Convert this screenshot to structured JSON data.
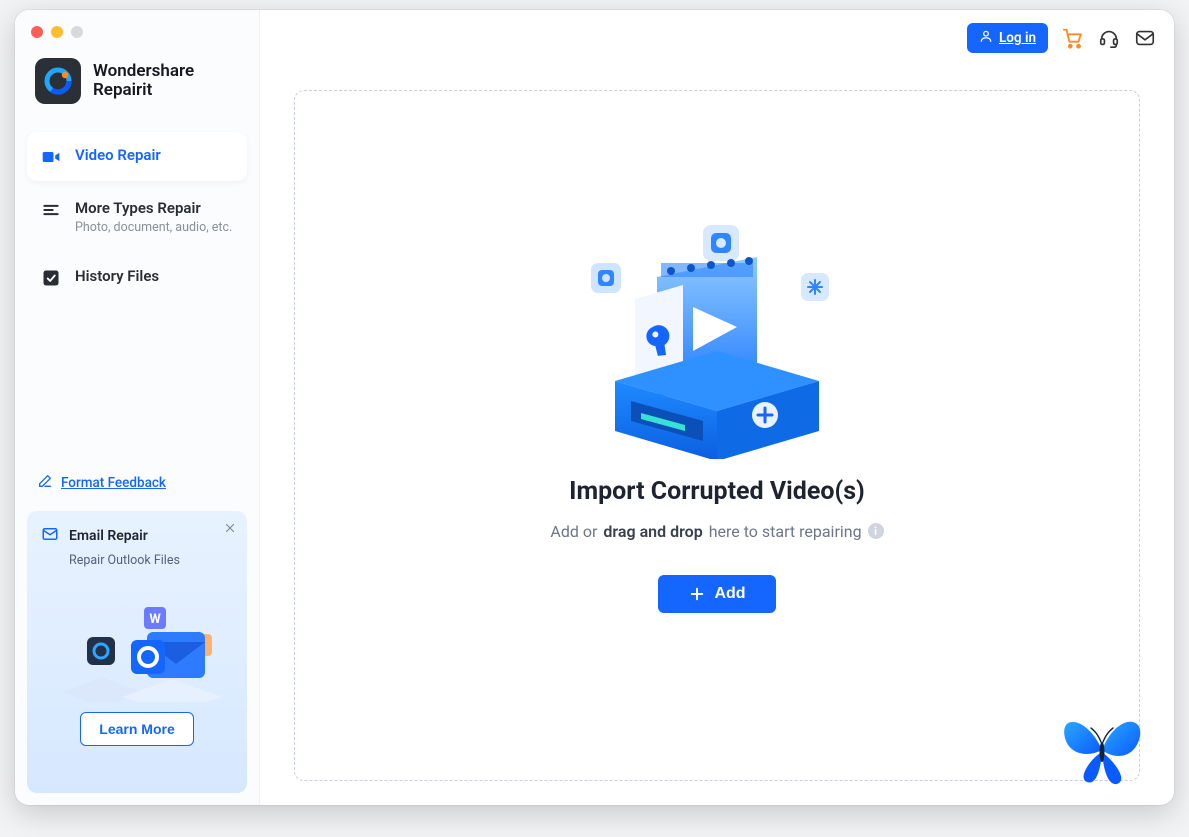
{
  "brand": {
    "line1": "Wondershare",
    "line2": "Repairit"
  },
  "sidebar": {
    "items": [
      {
        "label": "Video Repair"
      },
      {
        "label": "More Types Repair",
        "sub": "Photo, document, audio, etc."
      },
      {
        "label": "History Files"
      }
    ],
    "feedback_label": "Format Feedback"
  },
  "promo": {
    "title": "Email Repair",
    "sub": "Repair Outlook Files",
    "cta": "Learn More"
  },
  "topbar": {
    "login_label": "Log in"
  },
  "main": {
    "title": "Import Corrupted Video(s)",
    "sub_prefix": "Add or ",
    "sub_bold": "drag and drop",
    "sub_suffix": " here to start repairing",
    "add_label": "Add"
  }
}
